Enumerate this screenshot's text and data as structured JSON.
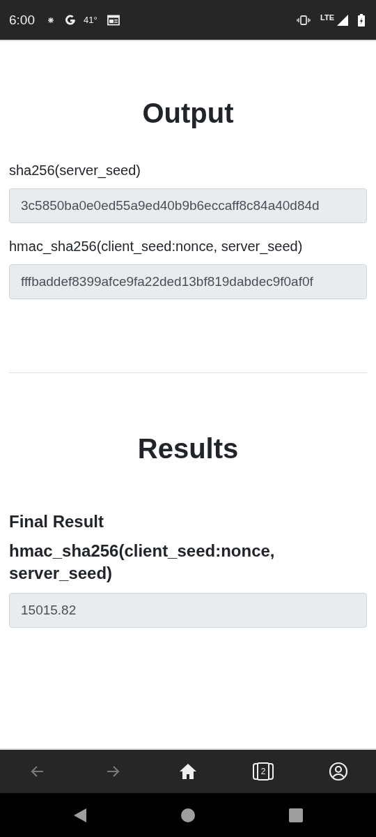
{
  "status_bar": {
    "time": "6:00",
    "temperature": "41°",
    "network": "LTE"
  },
  "output": {
    "title": "Output",
    "fields": [
      {
        "label": "sha256(server_seed)",
        "value": "3c5850ba0e0ed55a9ed40b9b6eccaff8c84a40d84d"
      },
      {
        "label": "hmac_sha256(client_seed:nonce, server_seed)",
        "value": "fffbaddef8399afce9fa22ded13bf819dabdec9f0af0f"
      }
    ]
  },
  "results": {
    "title": "Results",
    "subtitle": "Final Result",
    "label": "hmac_sha256(client_seed:nonce, server_seed)",
    "value": "15015.82"
  },
  "browser_toolbar": [
    {
      "kind": "back",
      "disabled": true
    },
    {
      "kind": "forward",
      "disabled": true
    },
    {
      "kind": "home",
      "disabled": false
    },
    {
      "kind": "tabs",
      "disabled": false,
      "count": "2"
    },
    {
      "kind": "account",
      "disabled": false
    }
  ]
}
